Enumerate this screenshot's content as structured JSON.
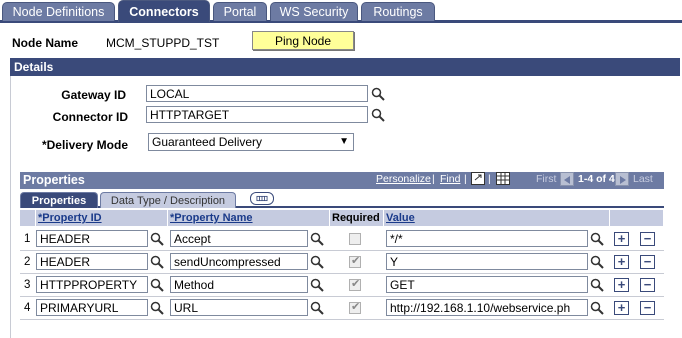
{
  "tabs": [
    {
      "label": "Node Definitions",
      "underline": "N"
    },
    {
      "label": "Connectors",
      "underline": ""
    },
    {
      "label": "Portal",
      "underline": "P"
    },
    {
      "label": "WS Security",
      "underline": "WS"
    },
    {
      "label": "Routings",
      "underline": ""
    }
  ],
  "node": {
    "label": "Node Name",
    "value": "MCM_STUPPD_TST",
    "ping_label": "Ping Node"
  },
  "details": {
    "title": "Details",
    "gateway_label": "Gateway ID",
    "gateway_value": "LOCAL",
    "connector_label": "Connector ID",
    "connector_value": "HTTPTARGET",
    "delivery_label": "*Delivery Mode",
    "delivery_value": "Guaranteed Delivery"
  },
  "properties": {
    "title": "Properties",
    "personalize": "Personalize",
    "find": "Find",
    "separator": "|",
    "first": "First",
    "range": "1-4 of 4",
    "last": "Last",
    "tabs": [
      "Properties",
      "Data Type / Description"
    ],
    "headers": {
      "property_id": "*Property ID",
      "property_name": "*Property Name",
      "required": "Required",
      "value": "Value"
    },
    "rows": [
      {
        "num": "1",
        "id": "HEADER",
        "name": "Accept",
        "required": false,
        "value": "*/*"
      },
      {
        "num": "2",
        "id": "HEADER",
        "name": "sendUncompressed",
        "required": true,
        "value": "Y"
      },
      {
        "num": "3",
        "id": "HTTPPROPERTY",
        "name": "Method",
        "required": true,
        "value": "GET"
      },
      {
        "num": "4",
        "id": "PRIMARYURL",
        "name": "URL",
        "required": true,
        "value": "http://192.168.1.10/webservice.ph"
      }
    ]
  },
  "icons": {
    "lookup": "magnifier-icon",
    "add": "plus-icon",
    "remove": "minus-icon",
    "grid": "view-all-icon"
  },
  "colors": {
    "header": "#3a4a7a",
    "tab": "#6d7ba3",
    "ping": "#ffff99",
    "grid_header": "#c5cbe0"
  }
}
